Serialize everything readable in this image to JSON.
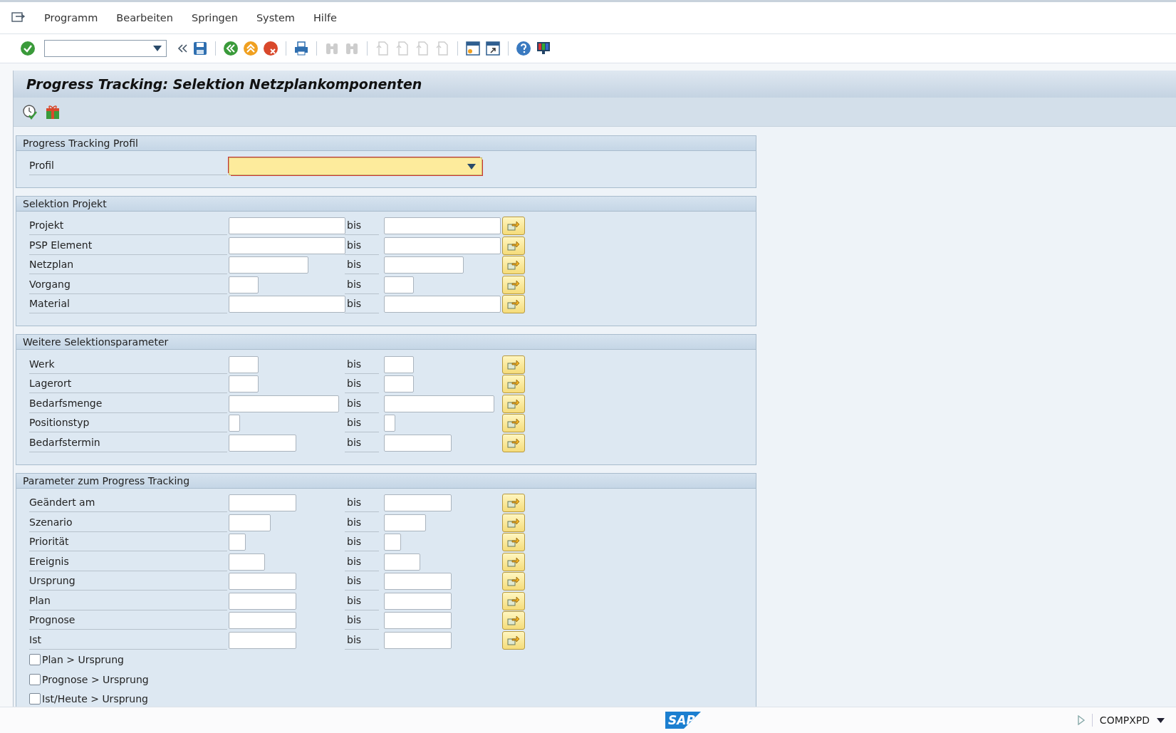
{
  "menu_bar": {
    "items": [
      "Programm",
      "Bearbeiten",
      "Springen",
      "System",
      "Hilfe"
    ]
  },
  "toolbar": {
    "items": [
      {
        "kind": "enter",
        "disabled": false
      },
      {
        "kind": "collapse",
        "disabled": false
      },
      {
        "kind": "save",
        "disabled": false
      },
      {
        "kind": "back",
        "disabled": false
      },
      {
        "kind": "exit",
        "disabled": false
      },
      {
        "kind": "cancel",
        "disabled": false
      },
      {
        "kind": "print",
        "disabled": false
      },
      {
        "kind": "find",
        "disabled": true
      },
      {
        "kind": "find-next",
        "disabled": true
      },
      {
        "kind": "first-page",
        "disabled": true
      },
      {
        "kind": "previous-page",
        "disabled": true
      },
      {
        "kind": "next-page",
        "disabled": true
      },
      {
        "kind": "last-page",
        "disabled": true
      },
      {
        "kind": "new-session",
        "disabled": false
      },
      {
        "kind": "shortcut",
        "disabled": false
      },
      {
        "kind": "help",
        "disabled": false
      },
      {
        "kind": "layout",
        "disabled": false
      }
    ]
  },
  "title": "Progress Tracking: Selektion Netzplankomponenten",
  "app_toolbar": [
    {
      "kind": "execute"
    },
    {
      "kind": "gift"
    }
  ],
  "groups": [
    {
      "title": "Progress Tracking Profil",
      "rows": [
        {
          "kind": "dropdown",
          "label": "Profil",
          "required": true
        }
      ]
    },
    {
      "title": "Selektion Projekt",
      "rows": [
        {
          "kind": "range",
          "label": "Projekt",
          "from": "",
          "to_label": "bis",
          "to": ""
        },
        {
          "kind": "range",
          "label": "PSP Element",
          "from": "",
          "to_label": "bis",
          "to": ""
        },
        {
          "kind": "range",
          "label": "Netzplan",
          "from": "",
          "to_label": "bis",
          "to": ""
        },
        {
          "kind": "range",
          "label": "Vorgang",
          "from": "",
          "to_label": "bis",
          "to": ""
        },
        {
          "kind": "range",
          "label": "Material",
          "from": "",
          "to_label": "bis",
          "to": ""
        }
      ]
    },
    {
      "title": "Weitere Selektionsparameter",
      "rows": [
        {
          "kind": "range",
          "label": "Werk",
          "from": "",
          "to_label": "bis",
          "to": ""
        },
        {
          "kind": "range",
          "label": "Lagerort",
          "from": "",
          "to_label": "bis",
          "to": ""
        },
        {
          "kind": "range",
          "label": "Bedarfsmenge",
          "from": "",
          "to_label": "bis",
          "to": ""
        },
        {
          "kind": "range",
          "label": "Positionstyp",
          "from": "",
          "to_label": "bis",
          "to": ""
        },
        {
          "kind": "range",
          "label": "Bedarfstermin",
          "from": "",
          "to_label": "bis",
          "to": ""
        }
      ]
    },
    {
      "title": "Parameter zum Progress Tracking",
      "rows": [
        {
          "kind": "range",
          "label": "Geändert am",
          "from": "",
          "to_label": "bis",
          "to": ""
        },
        {
          "kind": "range",
          "label": "Szenario",
          "from": "",
          "to_label": "bis",
          "to": ""
        },
        {
          "kind": "range",
          "label": "Priorität",
          "from": "",
          "to_label": "bis",
          "to": ""
        },
        {
          "kind": "range",
          "label": "Ereignis",
          "from": "",
          "to_label": "bis",
          "to": ""
        },
        {
          "kind": "range",
          "label": "Ursprung",
          "from": "",
          "to_label": "bis",
          "to": ""
        },
        {
          "kind": "range",
          "label": "Plan",
          "from": "",
          "to_label": "bis",
          "to": ""
        },
        {
          "kind": "range",
          "label": "Prognose",
          "from": "",
          "to_label": "bis",
          "to": ""
        },
        {
          "kind": "range",
          "label": "Ist",
          "from": "",
          "to_label": "bis",
          "to": ""
        },
        {
          "kind": "checkbox",
          "label": "Plan > Ursprung",
          "checked": false
        },
        {
          "kind": "checkbox",
          "label": "Prognose > Ursprung",
          "checked": false
        },
        {
          "kind": "checkbox",
          "label": "Ist/Heute > Ursprung",
          "checked": false
        }
      ]
    }
  ],
  "status_bar": {
    "logo": "SAP",
    "system": "COMPXPD"
  }
}
